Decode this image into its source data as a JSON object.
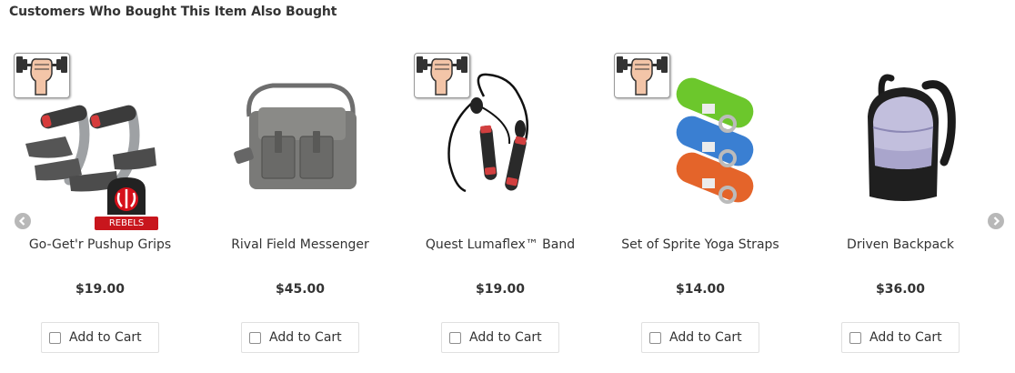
{
  "section": {
    "title": "Customers Who Bought This Item Also Bought"
  },
  "products": [
    {
      "name": "Go-Get'r Pushup Grips",
      "price": "$19.00",
      "add_to_cart": "Add to Cart",
      "badge_icon": "fitness-badge-icon",
      "extra_badge": "REBELS"
    },
    {
      "name": "Rival Field Messenger",
      "price": "$45.00",
      "add_to_cart": "Add to Cart"
    },
    {
      "name": "Quest Lumaflex™ Band",
      "price": "$19.00",
      "add_to_cart": "Add to Cart",
      "badge_icon": "fitness-badge-icon"
    },
    {
      "name": "Set of Sprite Yoga Straps",
      "price": "$14.00",
      "add_to_cart": "Add to Cart",
      "badge_icon": "fitness-badge-icon"
    },
    {
      "name": "Driven Backpack",
      "price": "$36.00",
      "add_to_cart": "Add to Cart"
    }
  ],
  "colors": {
    "rebels_red": "#c8161d",
    "yoga_green": "#6cc72c",
    "yoga_blue": "#3a7fd2",
    "yoga_orange": "#e4642a",
    "nav_gray": "#b8b8b8"
  }
}
